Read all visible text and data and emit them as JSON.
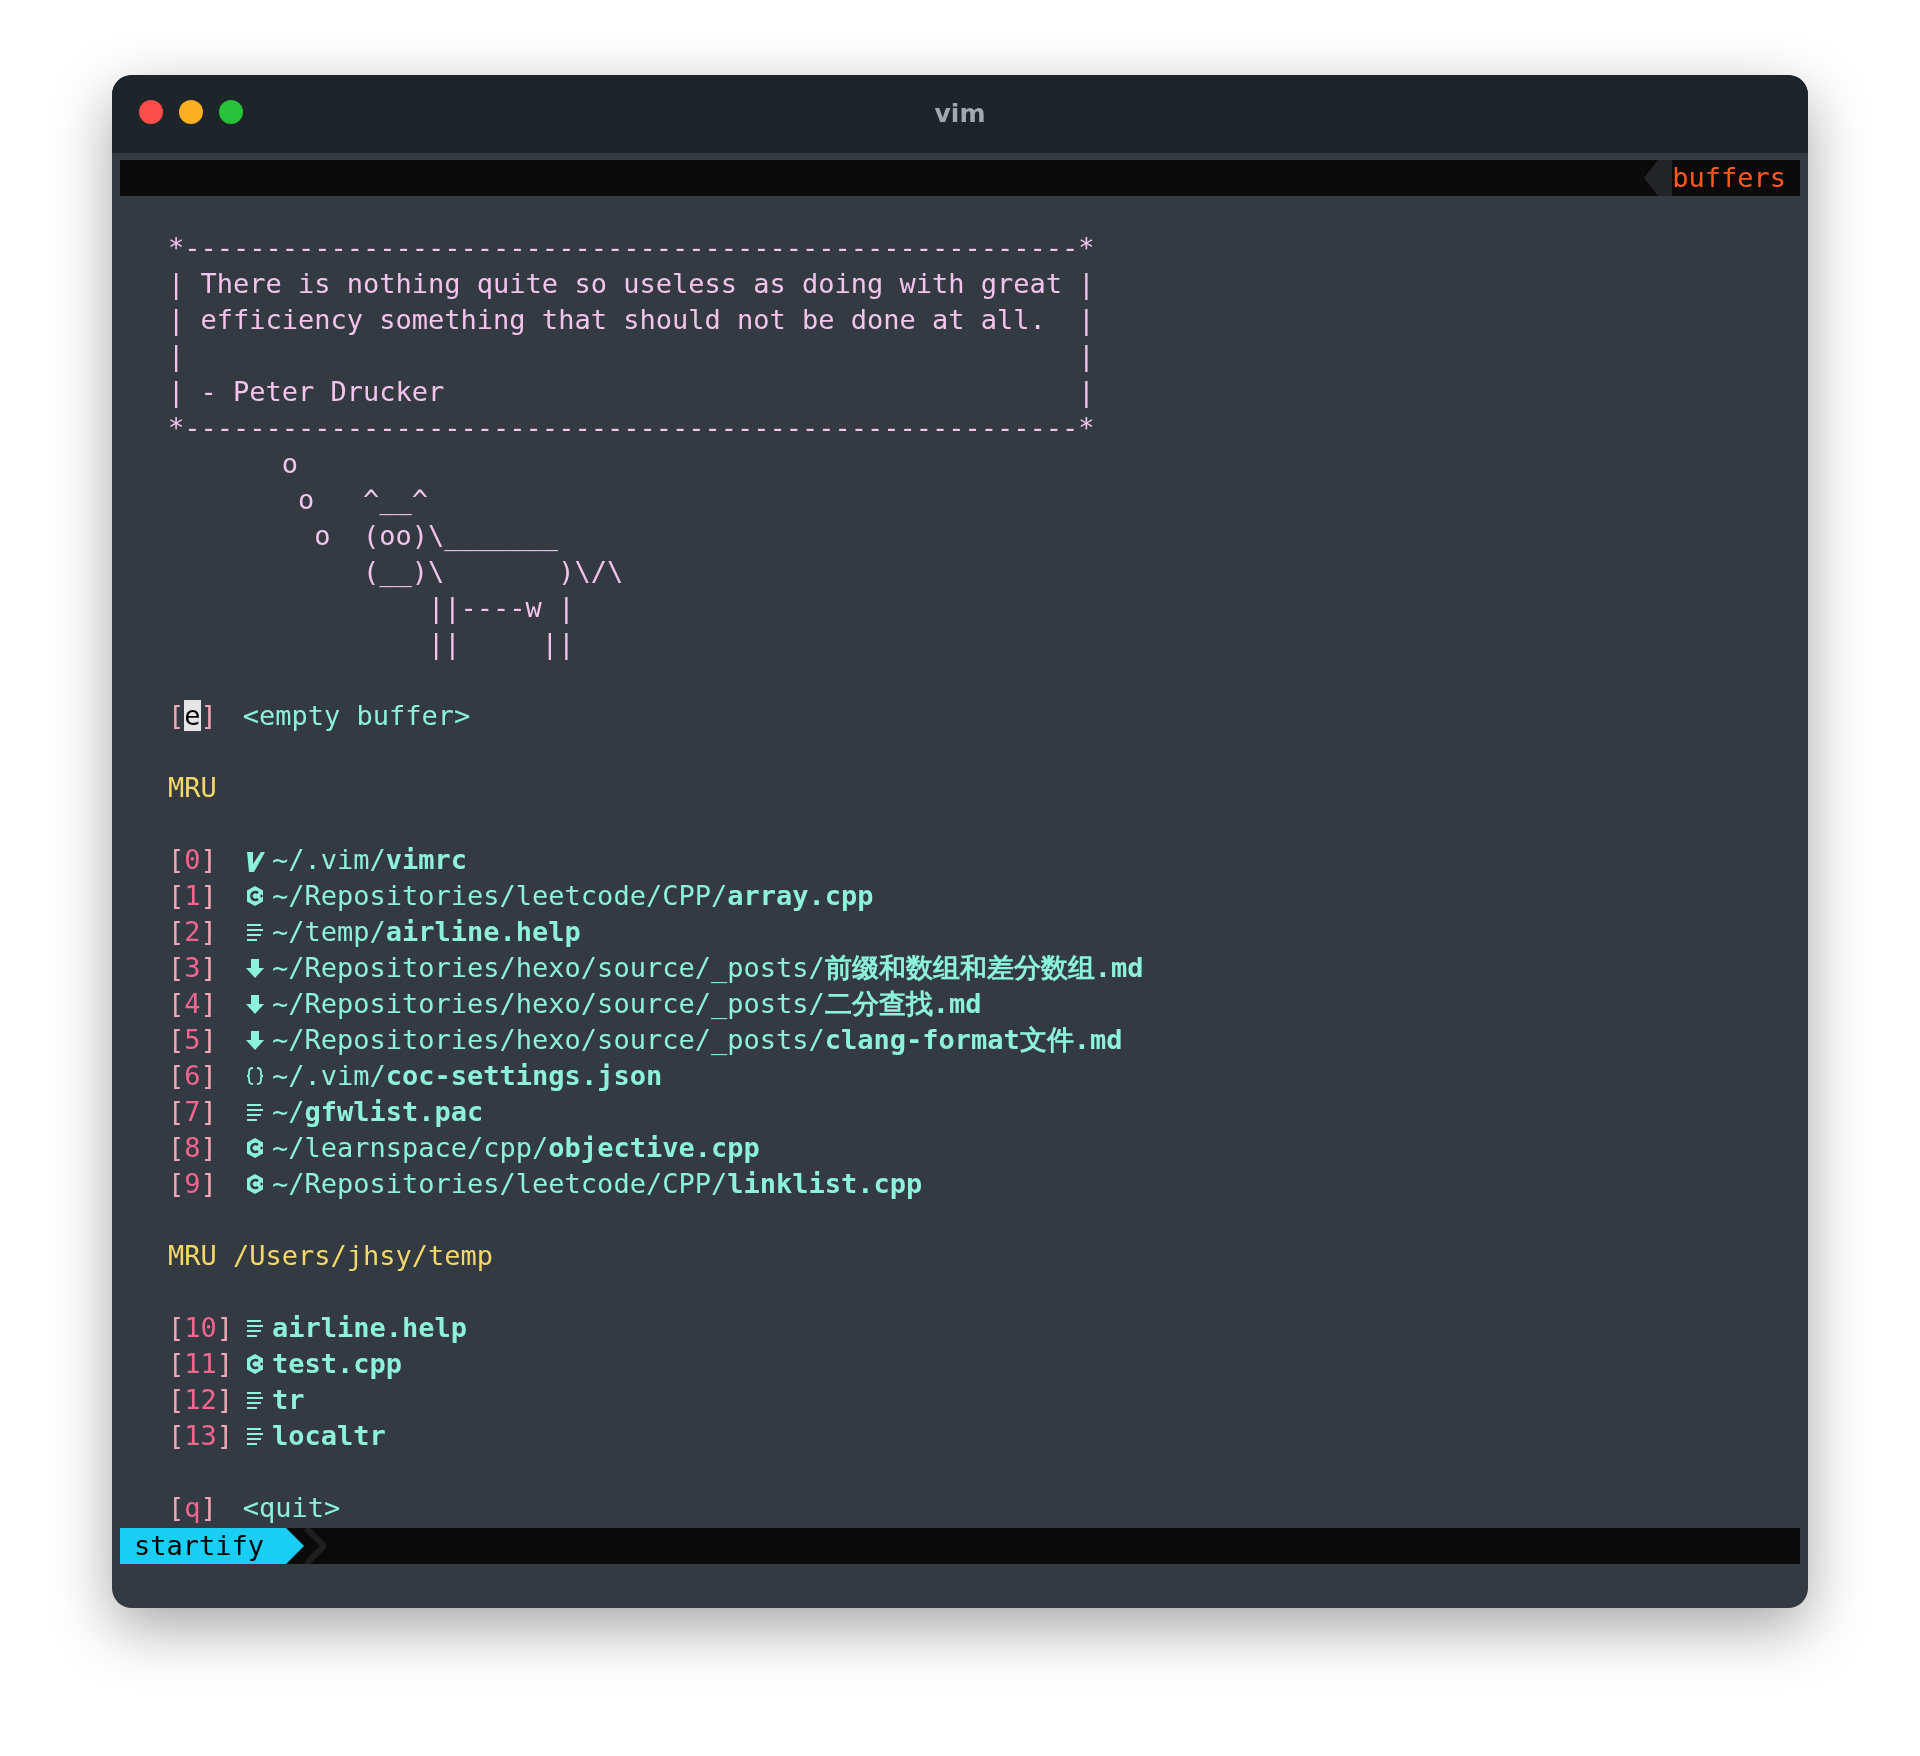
{
  "window": {
    "title": "vim"
  },
  "tabline": {
    "label": "buffers"
  },
  "header": [
    "*-------------------------------------------------------*",
    "| There is nothing quite so useless as doing with great |",
    "| efficiency something that should not be done at all.  |",
    "|                                                       |",
    "| - Peter Drucker                                       |",
    "*-------------------------------------------------------*",
    "       o",
    "        o   ^__^",
    "         o  (oo)\\_______",
    "            (__)\\       )\\/\\",
    "                ||----w |",
    "                ||     ||"
  ],
  "top_action": {
    "index": "[e]",
    "label": "<empty buffer>",
    "cursor": true
  },
  "sections": [
    {
      "title": "MRU",
      "items": [
        {
          "index": "[0]",
          "kind": "vim",
          "dir": "~/.vim/",
          "file": "vimrc"
        },
        {
          "index": "[1]",
          "kind": "cpp",
          "dir": "~/Repositories/leetcode/CPP/",
          "file": "array.cpp"
        },
        {
          "index": "[2]",
          "kind": "text",
          "dir": "~/temp/",
          "file": "airline.help"
        },
        {
          "index": "[3]",
          "kind": "markdown",
          "dir": "~/Repositories/hexo/source/_posts/",
          "file": "前缀和数组和差分数组.md"
        },
        {
          "index": "[4]",
          "kind": "markdown",
          "dir": "~/Repositories/hexo/source/_posts/",
          "file": "二分查找.md"
        },
        {
          "index": "[5]",
          "kind": "markdown",
          "dir": "~/Repositories/hexo/source/_posts/",
          "file": "clang-format文件.md"
        },
        {
          "index": "[6]",
          "kind": "json",
          "dir": "~/.vim/",
          "file": "coc-settings.json"
        },
        {
          "index": "[7]",
          "kind": "text",
          "dir": "~/",
          "file": "gfwlist.pac"
        },
        {
          "index": "[8]",
          "kind": "cpp",
          "dir": "~/learnspace/cpp/",
          "file": "objective.cpp"
        },
        {
          "index": "[9]",
          "kind": "cpp",
          "dir": "~/Repositories/leetcode/CPP/",
          "file": "linklist.cpp"
        }
      ]
    },
    {
      "title": "MRU /Users/jhsy/temp",
      "items": [
        {
          "index": "[10]",
          "kind": "text",
          "file": "airline.help"
        },
        {
          "index": "[11]",
          "kind": "cpp",
          "file": "test.cpp"
        },
        {
          "index": "[12]",
          "kind": "text",
          "file": "tr"
        },
        {
          "index": "[13]",
          "kind": "text",
          "file": "localtr"
        }
      ]
    }
  ],
  "bottom_action": {
    "index": "[q]",
    "label": "<quit>",
    "cursor": false
  },
  "statusline": {
    "mode": "startify"
  }
}
